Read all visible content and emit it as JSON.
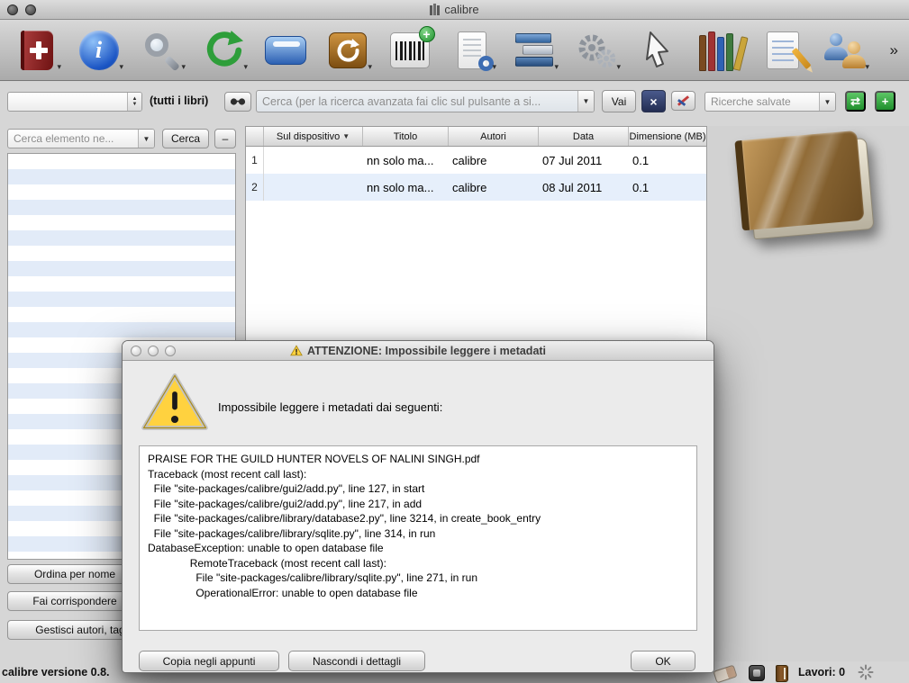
{
  "window": {
    "title": "calibre",
    "overflow_chevron": "»"
  },
  "toolbar": {
    "icons": [
      "add-books",
      "edit-metadata",
      "search",
      "convert-books",
      "send-to-device",
      "fetch-news",
      "get-books",
      "view",
      "library-stack",
      "preferences",
      "pointer",
      "library-shelf",
      "edit-notes",
      "users"
    ]
  },
  "filter_bar": {
    "library_combo_value": "",
    "all_books_label": "(tutti i libri)",
    "search_placeholder": "Cerca (per la ricerca avanzata fai clic sul pulsante a si...",
    "go_button": "Vai",
    "saved_searches_placeholder": "Ricerche salvate"
  },
  "tag_browser": {
    "find_placeholder": "Cerca elemento ne...",
    "find_button": "Cerca",
    "collapse_button": "–",
    "footer_buttons": [
      "Ordina per nome",
      "Fai corrispondere",
      "Gestisci autori, tag..."
    ]
  },
  "book_list": {
    "columns": [
      "Sul dispositivo",
      "Titolo",
      "Autori",
      "Data",
      "Dimensione (MB)"
    ],
    "sort_indicator": "▼",
    "rows": [
      {
        "num": "1",
        "on_device": "",
        "title": "nn solo ma...",
        "authors": "calibre",
        "date": "07 Jul 2011",
        "size": "0.1"
      },
      {
        "num": "2",
        "on_device": "",
        "title": "nn solo ma...",
        "authors": "calibre",
        "date": "08 Jul 2011",
        "size": "0.1"
      }
    ]
  },
  "dialog": {
    "title": "ATTENZIONE: Impossibile leggere i metadati",
    "message": "Impossibile leggere i metadati dai seguenti:",
    "details": [
      "PRAISE FOR THE GUILD HUNTER NOVELS OF NALINI SINGH.pdf",
      "Traceback (most recent call last):",
      "  File \"site-packages/calibre/gui2/add.py\", line 127, in start",
      "  File \"site-packages/calibre/gui2/add.py\", line 217, in add",
      "  File \"site-packages/calibre/library/database2.py\", line 3214, in create_book_entry",
      "  File \"site-packages/calibre/library/sqlite.py\", line 314, in run",
      "DatabaseException: unable to open database file",
      "              RemoteTraceback (most recent call last):",
      "                File \"site-packages/calibre/library/sqlite.py\", line 271, in run",
      "                OperationalError: unable to open database file"
    ],
    "copy_button": "Copia negli appunti",
    "hide_button": "Nascondi i dettagli",
    "ok_button": "OK"
  },
  "status_bar": {
    "version": "calibre versione 0.8.",
    "jobs": "Lavori: 0"
  },
  "colors": {
    "accent_green": "#2f9e44",
    "stripe_blue": "#e2ebf8",
    "row_alt_blue": "#e6effb",
    "warning_yellow": "#ffd23f",
    "add_books_red": "#8e2323",
    "info_blue": "#1b55c4"
  }
}
